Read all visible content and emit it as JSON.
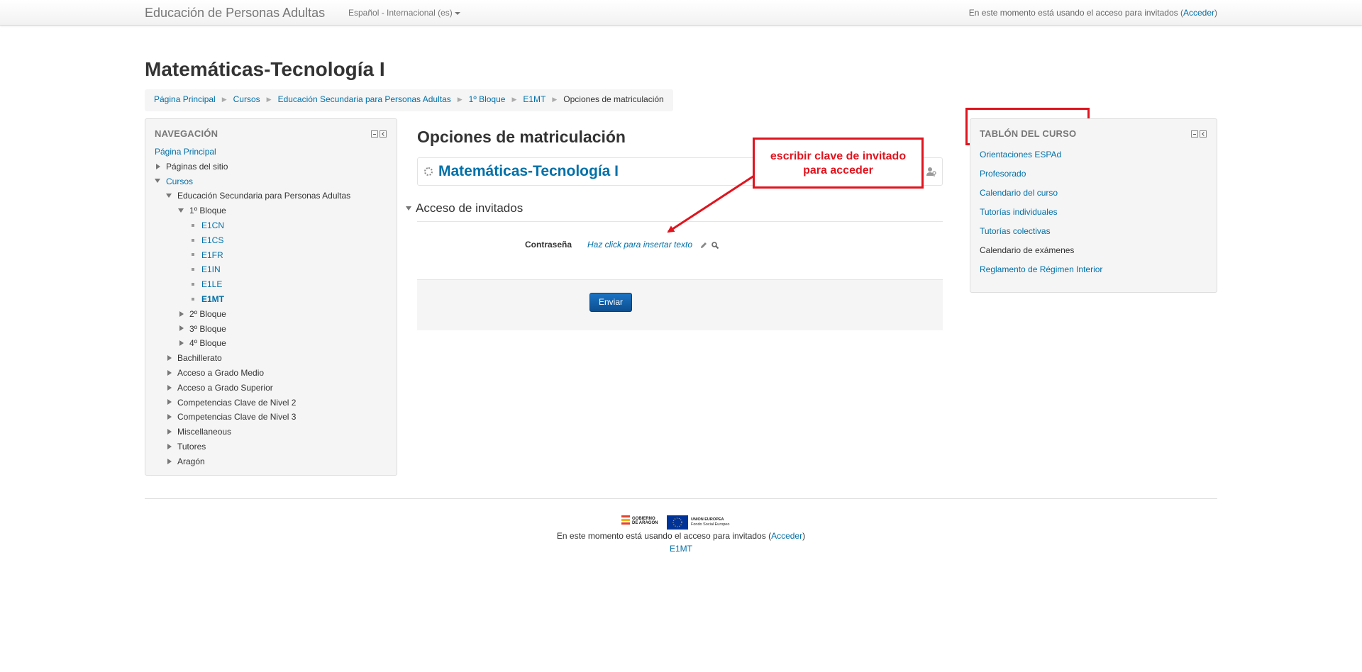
{
  "navbar": {
    "brand": "Educación de Personas Adultas",
    "language": "Español - Internacional (es)",
    "login_prefix": "En este momento está usando el acceso para invitados (",
    "login_link": "Acceder",
    "login_suffix": ")"
  },
  "page_title": "Matemáticas-Tecnología I",
  "breadcrumb": [
    "Página Principal",
    "Cursos",
    "Educación Secundaria para Personas Adultas",
    "1º Bloque",
    "E1MT",
    "Opciones de matriculación"
  ],
  "navigation": {
    "title": "NAVEGACIÓN",
    "items": [
      {
        "label": "Página Principal",
        "depth": 0,
        "marker": "none",
        "style": "link"
      },
      {
        "label": "Páginas del sitio",
        "depth": 0,
        "marker": "collapsed",
        "style": "text"
      },
      {
        "label": "Cursos",
        "depth": 0,
        "marker": "expanded",
        "style": "link"
      },
      {
        "label": "Educación Secundaria para Personas Adultas",
        "depth": 1,
        "marker": "expanded",
        "style": "text"
      },
      {
        "label": "1º Bloque",
        "depth": 2,
        "marker": "expanded",
        "style": "text"
      },
      {
        "label": "E1CN",
        "depth": 3,
        "marker": "bullet",
        "style": "link"
      },
      {
        "label": "E1CS",
        "depth": 3,
        "marker": "bullet",
        "style": "link"
      },
      {
        "label": "E1FR",
        "depth": 3,
        "marker": "bullet",
        "style": "link"
      },
      {
        "label": "E1IN",
        "depth": 3,
        "marker": "bullet",
        "style": "link"
      },
      {
        "label": "E1LE",
        "depth": 3,
        "marker": "bullet",
        "style": "link"
      },
      {
        "label": "E1MT",
        "depth": 3,
        "marker": "bullet",
        "style": "bold"
      },
      {
        "label": "2º Bloque",
        "depth": 2,
        "marker": "collapsed",
        "style": "text"
      },
      {
        "label": "3º Bloque",
        "depth": 2,
        "marker": "collapsed",
        "style": "text"
      },
      {
        "label": "4º Bloque",
        "depth": 2,
        "marker": "collapsed",
        "style": "text"
      },
      {
        "label": "Bachillerato",
        "depth": 1,
        "marker": "collapsed",
        "style": "text"
      },
      {
        "label": "Acceso a Grado Medio",
        "depth": 1,
        "marker": "collapsed",
        "style": "text"
      },
      {
        "label": "Acceso a Grado Superior",
        "depth": 1,
        "marker": "collapsed",
        "style": "text"
      },
      {
        "label": "Competencias Clave de Nivel 2",
        "depth": 1,
        "marker": "collapsed",
        "style": "text"
      },
      {
        "label": "Competencias Clave de Nivel 3",
        "depth": 1,
        "marker": "collapsed",
        "style": "text"
      },
      {
        "label": "Miscellaneous",
        "depth": 1,
        "marker": "collapsed",
        "style": "text"
      },
      {
        "label": "Tutores",
        "depth": 1,
        "marker": "collapsed",
        "style": "text"
      },
      {
        "label": "Aragón",
        "depth": 1,
        "marker": "collapsed",
        "style": "text"
      }
    ]
  },
  "main": {
    "heading": "Opciones de matriculación",
    "course_name": "Matemáticas-Tecnología I",
    "section_title": "Acceso de invitados",
    "password_label": "Contraseña",
    "password_placeholder": "Haz click para insertar texto",
    "submit_label": "Enviar"
  },
  "annotation": {
    "line1": "escribir clave de invitado",
    "line2": "para acceder",
    "color": "#e0141e"
  },
  "tablon": {
    "title": "TABLÓN DEL CURSO",
    "items": [
      {
        "label": "Orientaciones ESPAd",
        "style": "link"
      },
      {
        "label": "Profesorado",
        "style": "link"
      },
      {
        "label": "Calendario del curso",
        "style": "link"
      },
      {
        "label": "Tutorías individuales",
        "style": "link"
      },
      {
        "label": "Tutorías colectivas",
        "style": "link"
      },
      {
        "label": "Calendario de exámenes",
        "style": "plain"
      },
      {
        "label": "Reglamento de Régimen Interior",
        "style": "link"
      }
    ]
  },
  "footer": {
    "logo1_line1": "GOBIERNO",
    "logo1_line2": "DE ARAGON",
    "logo2_line1": "UNION EUROPEA",
    "logo2_line2": "Fondo Social Europeo",
    "login_prefix": "En este momento está usando el acceso para invitados (",
    "login_link": "Acceder",
    "login_suffix": ")",
    "course_link": "E1MT"
  },
  "colors": {
    "link": "#0070a8",
    "button": "#0d5ea8",
    "annotation": "#e0141e"
  }
}
